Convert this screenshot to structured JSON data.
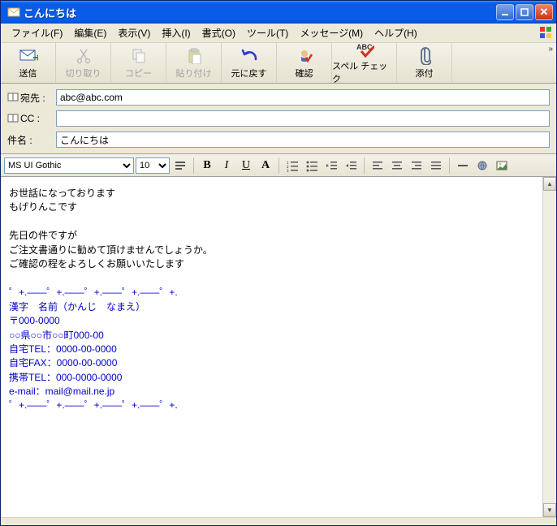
{
  "window": {
    "title": "こんにちは"
  },
  "menu": {
    "file": "ファイル(F)",
    "edit": "編集(E)",
    "view": "表示(V)",
    "insert": "挿入(I)",
    "format": "書式(O)",
    "tools": "ツール(T)",
    "message": "メッセージ(M)",
    "help": "ヘルプ(H)"
  },
  "toolbar": {
    "send": "送信",
    "cut": "切り取り",
    "copy": "コピー",
    "paste": "貼り付け",
    "undo": "元に戻す",
    "check": "確認",
    "spell": "スペル チェック",
    "attach": "添付"
  },
  "headers": {
    "to_label": "宛先 :",
    "to_value": "abc@abc.com",
    "cc_label": "CC :",
    "cc_value": "",
    "subject_label": "件名 :",
    "subject_value": "こんにちは"
  },
  "format": {
    "font_name": "MS UI Gothic",
    "font_size": "10"
  },
  "body": "お世話になっております\nもげりんこです\n\n先日の件ですが\nご注文書通りに勧めて頂けませんでしょうか。\nご確認の程をよろしくお願いいたします",
  "signature": "゜+.――゜+.――゜+.――゜+.――゜+.\n漢字　名前（かんじ　なまえ）\n〒000-0000\n○○県○○市○○町000-00\n自宅TEL：0000-00-0000\n自宅FAX：0000-00-0000\n携帯TEL：000-0000-0000\ne-mail：mail@mail.ne.jp\n゜+.――゜+.――゜+.――゜+.――゜+."
}
